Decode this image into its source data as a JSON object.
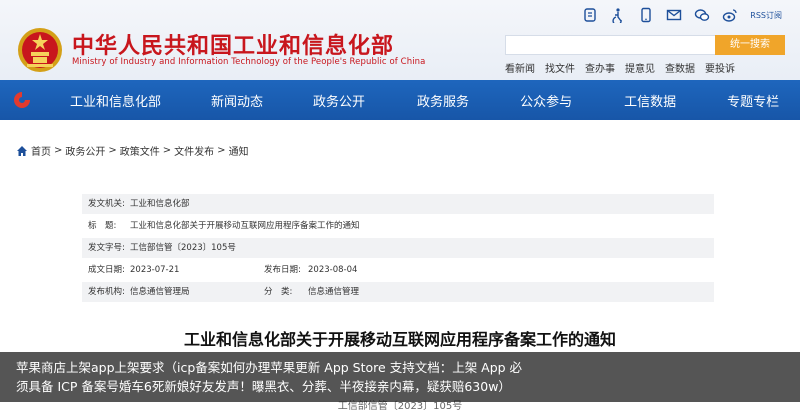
{
  "header": {
    "title": "中华人民共和国工业和信息化部",
    "subtitle": "Ministry of Industry and Information Technology of the People's Republic of China",
    "rss_label": "RSS订阅",
    "search": {
      "placeholder": "",
      "button_label": "统一搜索"
    },
    "quick_links": [
      "看新闻",
      "找文件",
      "查办事",
      "提意见",
      "查数据",
      "要投诉"
    ]
  },
  "nav": {
    "items": [
      "工业和信息化部",
      "新闻动态",
      "政务公开",
      "政务服务",
      "公众参与",
      "工信数据",
      "专题专栏"
    ]
  },
  "breadcrumb": {
    "items": [
      "首页",
      "政务公开",
      "政策文件",
      "文件发布",
      "通知"
    ],
    "separator": ">"
  },
  "meta": {
    "issuer_label": "发文机关:",
    "issuer": "工业和信息化部",
    "title_label": "标　题:",
    "title": "工业和信息化部关于开展移动互联网应用程序备案工作的通知",
    "doc_no_label": "发文字号:",
    "doc_no": "工信部信管〔2023〕105号",
    "created_label": "成文日期:",
    "created": "2023-07-21",
    "published_label": "发布日期:",
    "published": "2023-08-04",
    "publisher_label": "发布机构:",
    "publisher": "信息通信管理局",
    "category_label": "分　类:",
    "category": "信息通信管理"
  },
  "document": {
    "title": "工业和信息化部关于开展移动互联网应用程序备案工作的通知",
    "number": "工信部信管〔2023〕105号"
  },
  "overlay": {
    "line1": "苹果商店上架app上架要求（icp备案如何办理苹果更新 App Store 支持文档：上架 App 必",
    "line2": "须具备 ICP 备案号婚车6死新娘好友发声！曝黑衣、分葬、半夜接亲内幕，疑获赔630w）"
  },
  "colors": {
    "brand_red": "#c8161d",
    "nav_blue": "#1a5fb4",
    "search_orange": "#f0a52a"
  }
}
